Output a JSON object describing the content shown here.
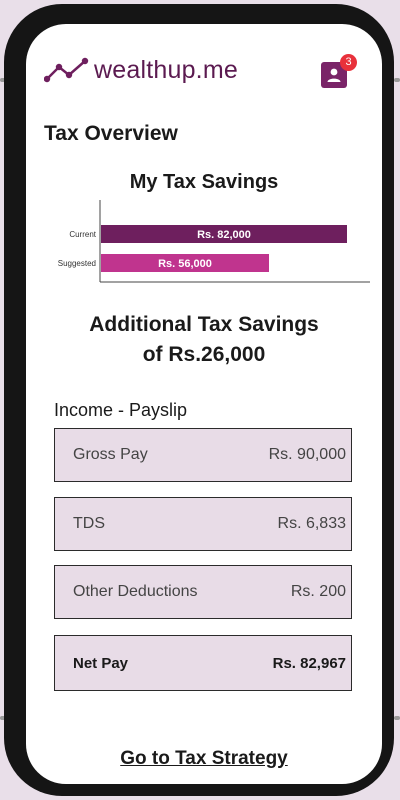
{
  "app": {
    "logo_text": "wealthup.me",
    "notification_count": "3"
  },
  "page": {
    "title": "Tax Overview"
  },
  "chart_data": {
    "type": "bar",
    "orientation": "horizontal",
    "title": "My Tax Savings",
    "categories": [
      "Current",
      "Suggested"
    ],
    "values": [
      82000,
      56000
    ],
    "data_labels": [
      "Rs. 82,000",
      "Rs. 56,000"
    ],
    "colors": [
      "#6e1f5e",
      "#c0348e"
    ],
    "xlim": [
      0,
      90000
    ],
    "grid": false,
    "legend": "none"
  },
  "summary": {
    "line1": "Additional Tax Savings",
    "line2": "of Rs.26,000"
  },
  "income": {
    "title": "Income - Payslip",
    "rows": [
      {
        "label": "Gross Pay",
        "value": "Rs. 90,000"
      },
      {
        "label": "TDS",
        "value": "Rs. 6,833"
      },
      {
        "label": "Other Deductions",
        "value": "Rs. 200"
      },
      {
        "label": "Net Pay",
        "value": "Rs. 82,967"
      }
    ]
  },
  "cta": {
    "label": "Go to Tax Strategy"
  }
}
